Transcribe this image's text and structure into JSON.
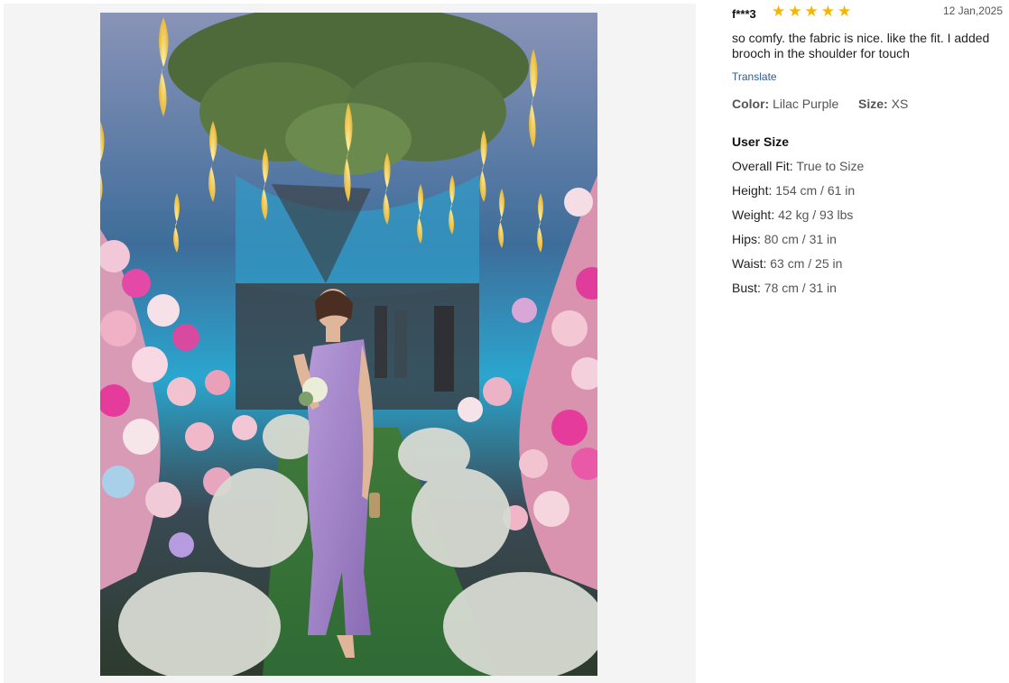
{
  "review": {
    "username": "f***3",
    "rating": 5,
    "date": "12 Jan,2025",
    "text": "so comfy. the fabric is nice. like the fit. I added brooch in the shoulder for touch",
    "translate_label": "Translate",
    "color_label": "Color:",
    "color_value": "Lilac Purple",
    "size_label": "Size:",
    "size_value": "XS"
  },
  "user_size": {
    "title": "User Size",
    "rows": [
      {
        "label": "Overall Fit:",
        "value": "True to Size"
      },
      {
        "label": "Height:",
        "value": "154 cm / 61 in"
      },
      {
        "label": "Weight:",
        "value": "42 kg / 93 lbs"
      },
      {
        "label": "Hips:",
        "value": "80 cm / 31 in"
      },
      {
        "label": "Waist:",
        "value": "63 cm / 25 in"
      },
      {
        "label": "Bust:",
        "value": "78 cm / 31 in"
      }
    ]
  },
  "icons": {
    "star": "star-icon"
  },
  "colors": {
    "star": "#f7b500",
    "link": "#2a5a9a",
    "dress": "#a487c9"
  }
}
